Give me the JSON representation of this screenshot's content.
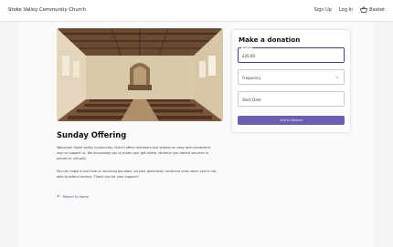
{
  "header": {
    "brand": "Stoke Valley Community Church",
    "nav": {
      "signup": "Sign Up",
      "login": "Log In",
      "basket": "Basket"
    }
  },
  "hero": {
    "image": "church-interior-pews"
  },
  "page": {
    "title": "Sunday Offering",
    "paragraph1": "Welcome! Stoke Valley Community Church offers members and visitors an easy and convenient way to support us. We encourage you to make your gift online, whether you attend services in person or virtually.",
    "paragraph2": "You can make a one-time or recurring donation, so your generosity continues even when you're not able to attend service. Thank you for your support!",
    "back_link": "Return to home"
  },
  "donation": {
    "title": "Make a donation",
    "amount_label": "Amount",
    "amount_value": "£20.00",
    "frequency_placeholder": "Frequency",
    "start_date_placeholder": "Start Date",
    "add_button": "Add to Basket"
  },
  "colors": {
    "accent": "#4a3d8f",
    "button": "#6a5fae",
    "page_bg": "#fafafb"
  }
}
